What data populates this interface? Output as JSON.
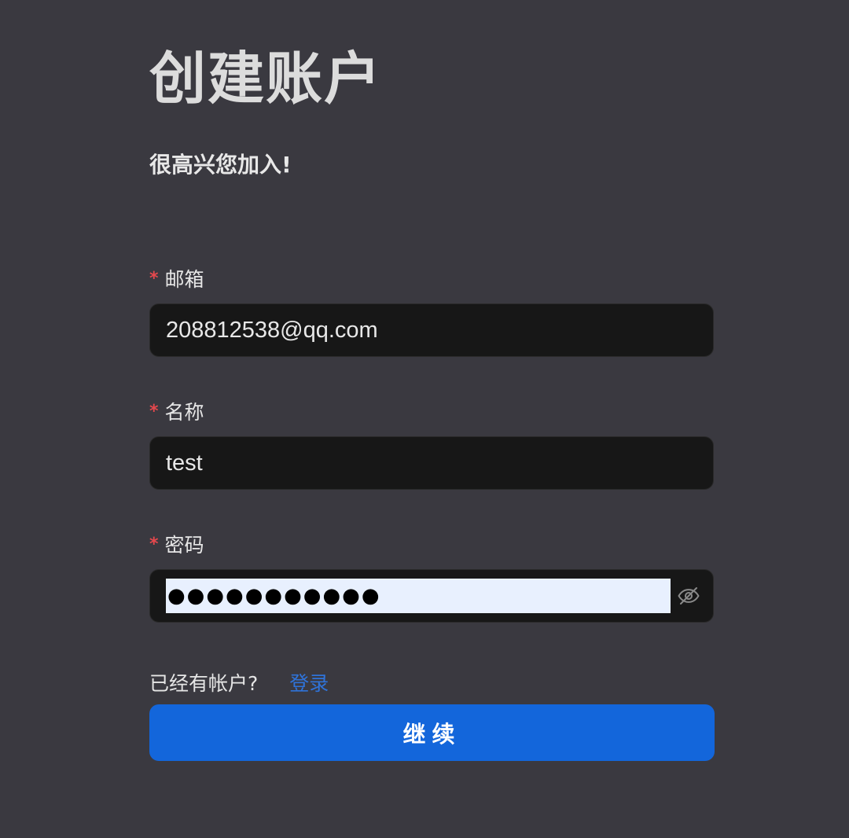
{
  "header": {
    "title": "创建账户",
    "subtitle": "很高兴您加入!"
  },
  "form": {
    "required_mark": "*",
    "email": {
      "label": "邮箱",
      "value": "208812538@qq.com"
    },
    "name": {
      "label": "名称",
      "value": "test"
    },
    "password": {
      "label": "密码",
      "value": "●●●●●●●●●●●",
      "visibility_icon": "eye-off-icon",
      "autofill_color": "#e8f0fe"
    }
  },
  "footer": {
    "have_account_text": "已经有帐户?",
    "login_link": "登录",
    "continue_label": "继续"
  },
  "colors": {
    "background": "#3a3940",
    "input_background": "#171717",
    "required": "#e5484d",
    "link": "#2f73d9",
    "primary_button": "#1366db"
  }
}
